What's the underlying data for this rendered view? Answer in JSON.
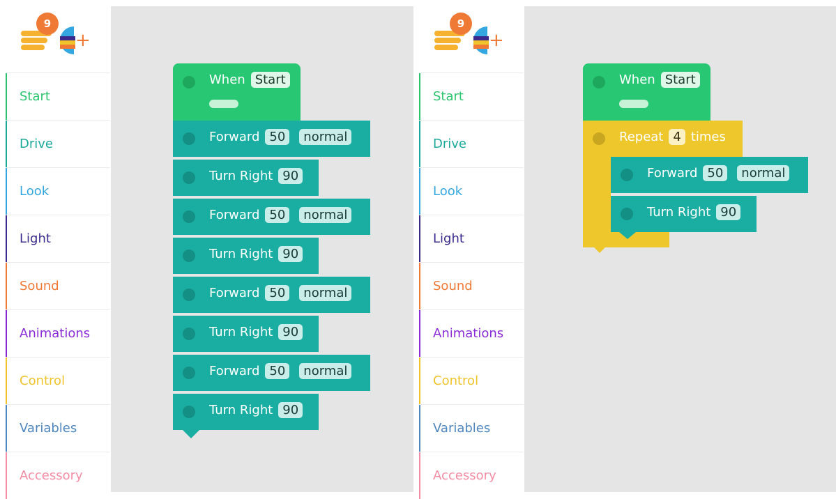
{
  "notification_count": "9",
  "icons": {
    "menu": "hamburger-menu-icon",
    "add": "add-extension-icon"
  },
  "categories": [
    {
      "label": "Start",
      "color": "#2cc46e"
    },
    {
      "label": "Drive",
      "color": "#19a89a"
    },
    {
      "label": "Look",
      "color": "#34a7e0"
    },
    {
      "label": "Light",
      "color": "#3b2a8c"
    },
    {
      "label": "Sound",
      "color": "#ef7a36"
    },
    {
      "label": "Animations",
      "color": "#8a2bd6"
    },
    {
      "label": "Control",
      "color": "#f0c32b"
    },
    {
      "label": "Variables",
      "color": "#4e86be"
    },
    {
      "label": "Accessory",
      "color": "#f48ca4"
    }
  ],
  "colors": {
    "start_block": "#27c773",
    "drive_block": "#1aaea2",
    "control_block": "#eec72c",
    "canvas": "#e5e5e5"
  },
  "program_left": {
    "hat": {
      "label": "When",
      "value": "Start"
    },
    "steps": [
      {
        "label": "Forward",
        "value": "50",
        "speed": "normal"
      },
      {
        "label": "Turn Right",
        "value": "90"
      },
      {
        "label": "Forward",
        "value": "50",
        "speed": "normal"
      },
      {
        "label": "Turn Right",
        "value": "90"
      },
      {
        "label": "Forward",
        "value": "50",
        "speed": "normal"
      },
      {
        "label": "Turn Right",
        "value": "90"
      },
      {
        "label": "Forward",
        "value": "50",
        "speed": "normal"
      },
      {
        "label": "Turn Right",
        "value": "90"
      }
    ]
  },
  "program_right": {
    "hat": {
      "label": "When",
      "value": "Start"
    },
    "repeat": {
      "label": "Repeat",
      "count": "4",
      "suffix": "times"
    },
    "body": [
      {
        "label": "Forward",
        "value": "50",
        "speed": "normal"
      },
      {
        "label": "Turn Right",
        "value": "90"
      }
    ]
  }
}
